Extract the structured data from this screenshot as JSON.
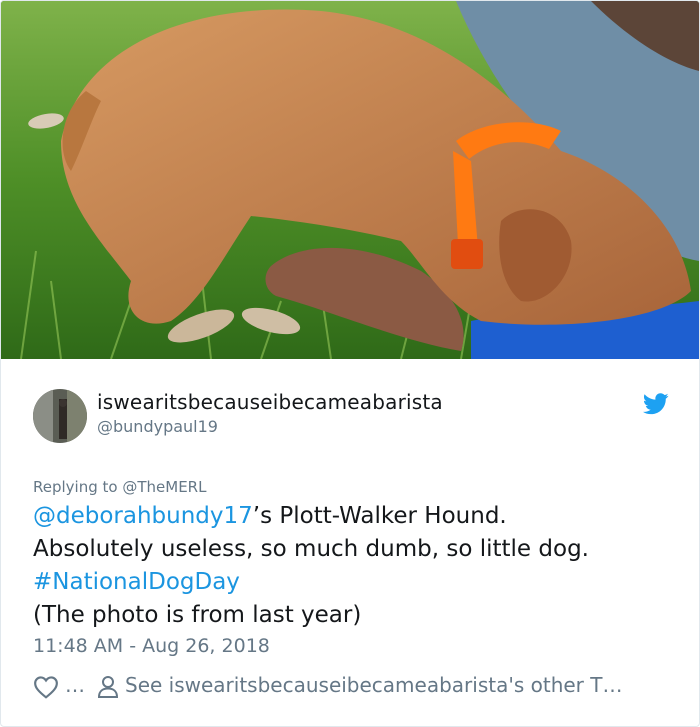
{
  "tweet": {
    "display_name": "iswearitsbecauseibecameabarista",
    "handle": "@bundypaul19",
    "reply_prefix": "Replying to",
    "reply_to": "@TheMERL",
    "mention": "@deborahbundy17",
    "line1_rest": "’s Plott-Walker Hound.",
    "line2": "Absolutely useless, so much dumb, so little dog.",
    "hashtag": "#NationalDogDay",
    "line4": "(The photo is from last year)",
    "timestamp": "11:48 AM - Aug 26, 2018",
    "like_count": "…",
    "other_tweets_label": "See iswearitsbecauseibecameabarista's other T…"
  },
  "icons": {
    "brand": "twitter-bird-icon",
    "like": "heart-icon",
    "profile": "person-icon"
  },
  "colors": {
    "link": "#1b95e0",
    "text": "#14171a",
    "muted": "#657786",
    "border": "#e1e8ed"
  }
}
